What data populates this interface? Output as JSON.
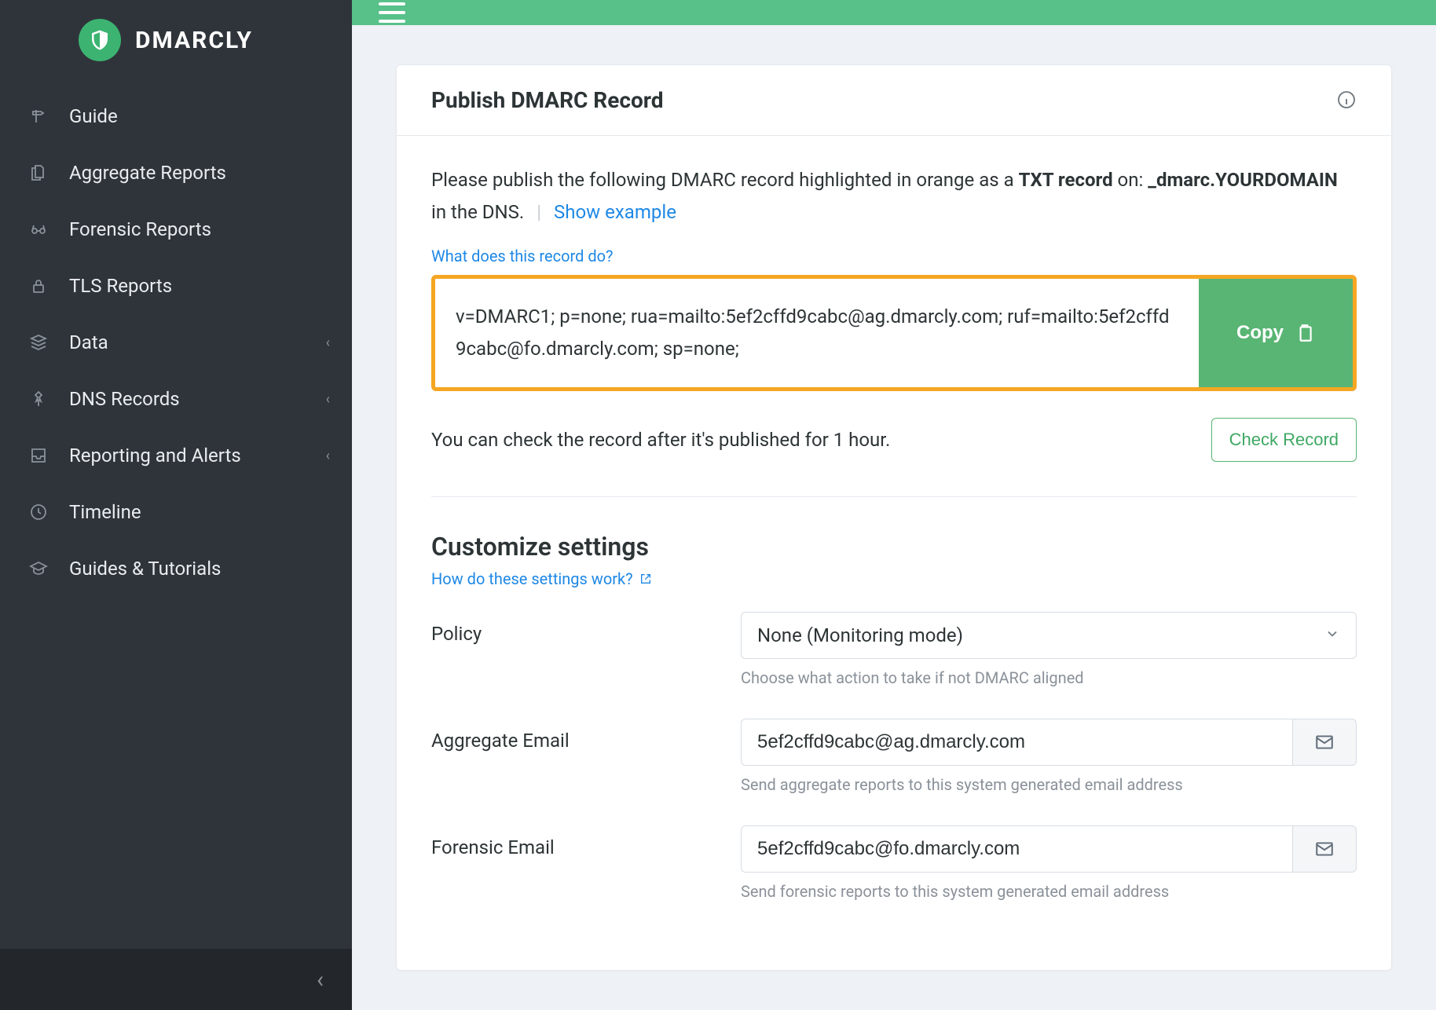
{
  "brand": {
    "name": "DMARCLY"
  },
  "sidebar": {
    "items": [
      {
        "label": "Guide",
        "icon": "signpost-icon",
        "expandable": false
      },
      {
        "label": "Aggregate Reports",
        "icon": "files-icon",
        "expandable": false
      },
      {
        "label": "Forensic Reports",
        "icon": "glasses-icon",
        "expandable": false
      },
      {
        "label": "TLS Reports",
        "icon": "lock-icon",
        "expandable": false
      },
      {
        "label": "Data",
        "icon": "layers-icon",
        "expandable": true
      },
      {
        "label": "DNS Records",
        "icon": "pin-icon",
        "expandable": true
      },
      {
        "label": "Reporting and Alerts",
        "icon": "inbox-icon",
        "expandable": true
      },
      {
        "label": "Timeline",
        "icon": "clock-icon",
        "expandable": false
      },
      {
        "label": "Guides & Tutorials",
        "icon": "graduation-icon",
        "expandable": false
      }
    ]
  },
  "card": {
    "title": "Publish DMARC Record",
    "intro_prefix": "Please publish the following DMARC record highlighted in orange as a ",
    "intro_bold1": "TXT record",
    "intro_mid": " on: ",
    "intro_bold2": "_dmarc.YOURDOMAIN",
    "intro_suffix": " in the DNS.",
    "show_example": "Show example",
    "what_link": "What does this record do?",
    "record_value": "v=DMARC1; p=none; rua=mailto:5ef2cffd9cabc@ag.dmarcly.com; ruf=mailto:5ef2cffd9cabc@fo.dmarcly.com; sp=none;",
    "copy_label": "Copy",
    "check_text": "You can check the record after it's published for 1 hour.",
    "check_button": "Check Record"
  },
  "customize": {
    "title": "Customize settings",
    "help_link": "How do these settings work?",
    "fields": {
      "policy": {
        "label": "Policy",
        "value": "None (Monitoring mode)",
        "help": "Choose what action to take if not DMARC aligned"
      },
      "aggregate": {
        "label": "Aggregate Email",
        "value": "5ef2cffd9cabc@ag.dmarcly.com",
        "help": "Send aggregate reports to this system generated email address"
      },
      "forensic": {
        "label": "Forensic Email",
        "value": "5ef2cffd9cabc@fo.dmarcly.com",
        "help": "Send forensic reports to this system generated email address"
      }
    }
  },
  "colors": {
    "accent": "#58c18a",
    "highlight_border": "#f5a623",
    "link": "#1e88e5"
  }
}
